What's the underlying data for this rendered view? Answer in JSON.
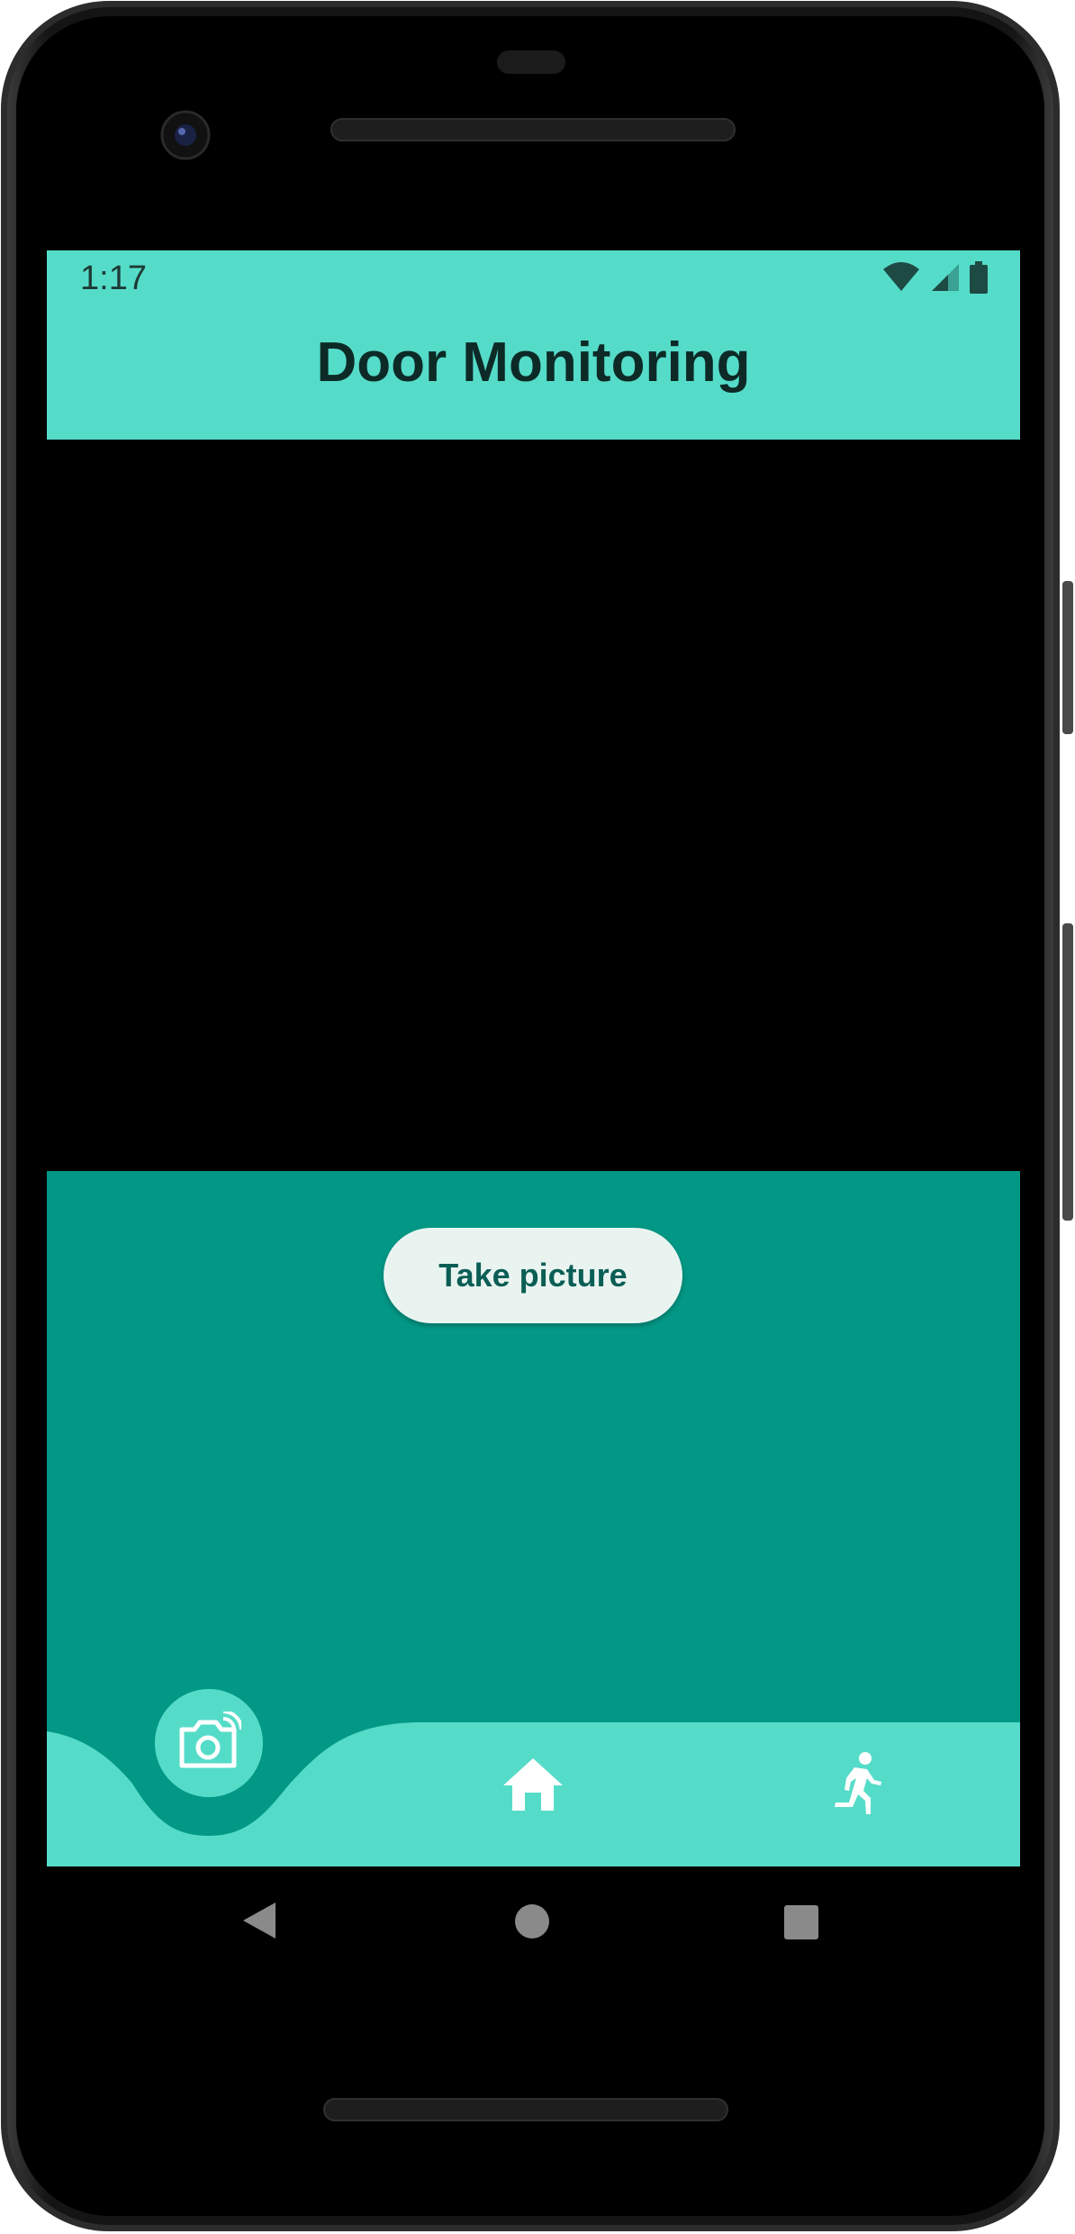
{
  "status_bar": {
    "time": "1:17",
    "icons": [
      "wifi-icon",
      "cell-signal-icon",
      "battery-icon"
    ]
  },
  "app_bar": {
    "title": "Door Monitoring"
  },
  "main": {
    "take_picture_label": "Take picture"
  },
  "bottom_nav": {
    "items": [
      {
        "icon": "camera-icon",
        "selected": true
      },
      {
        "icon": "home-icon",
        "selected": false
      },
      {
        "icon": "running-person-icon",
        "selected": false
      }
    ]
  },
  "system_nav": {
    "buttons": [
      "back-icon",
      "home-circle-icon",
      "recents-icon"
    ]
  },
  "colors": {
    "accent": "#55dcc9",
    "body": "#039886",
    "button_bg": "#e9f4f1",
    "button_text": "#0b5e55"
  }
}
